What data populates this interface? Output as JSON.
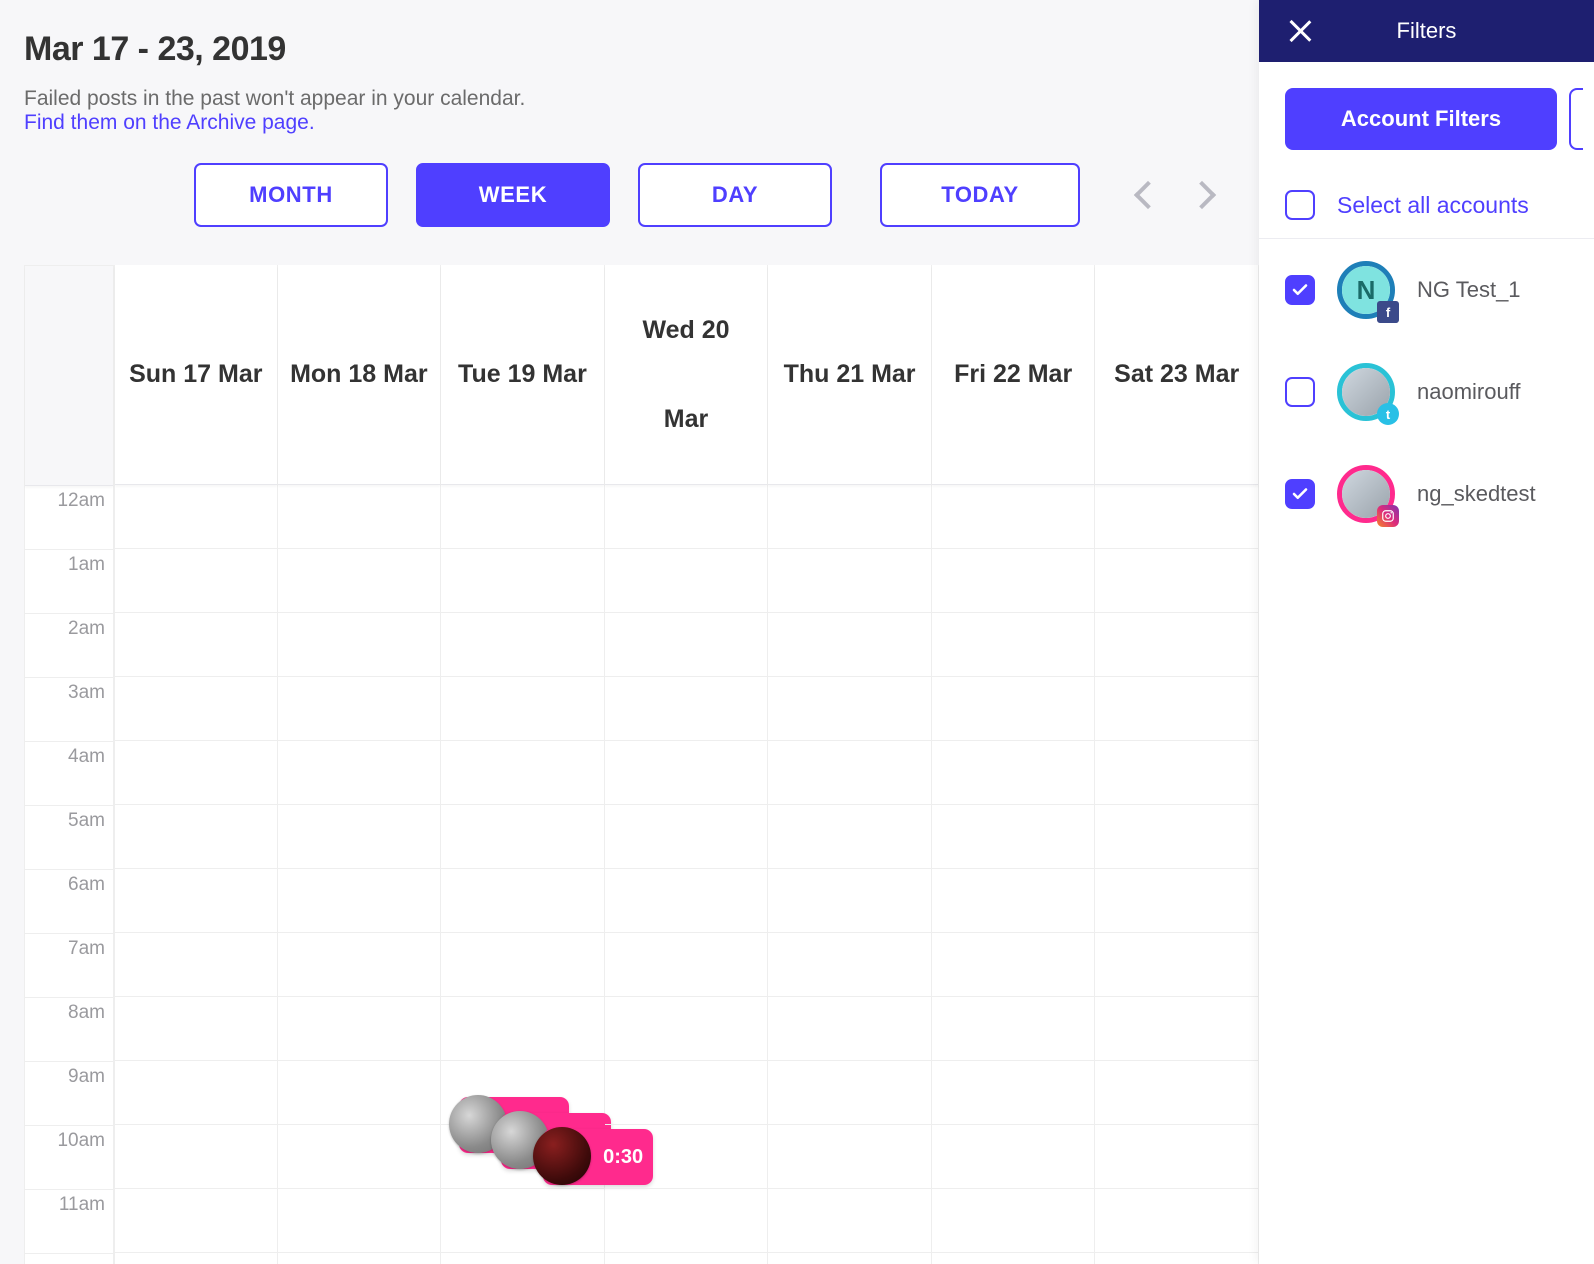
{
  "header": {
    "date_range": "Mar 17 - 23, 2019",
    "notice_text": "Failed posts in the past won't appear in your calendar.",
    "notice_link": "Find them on the Archive page."
  },
  "toolbar": {
    "month": "MONTH",
    "week": "WEEK",
    "day": "DAY",
    "today": "TODAY",
    "active_view": "week"
  },
  "calendar": {
    "days": [
      {
        "line1": "Sun 17 Mar",
        "line2": ""
      },
      {
        "line1": "Mon 18 Mar",
        "line2": ""
      },
      {
        "line1": "Tue 19 Mar",
        "line2": ""
      },
      {
        "line1": "Wed 20",
        "line2": "Mar"
      },
      {
        "line1": "Thu 21 Mar",
        "line2": ""
      },
      {
        "line1": "Fri 22 Mar",
        "line2": ""
      },
      {
        "line1": "Sat 23 Mar",
        "line2": ""
      }
    ],
    "hours": [
      "12am",
      "1am",
      "2am",
      "3am",
      "4am",
      "5am",
      "6am",
      "7am",
      "8am",
      "9am",
      "10am",
      "11am"
    ],
    "events": {
      "day_index": 2,
      "start_hour_index": 10,
      "visible_time_label": "0:30",
      "count": 3,
      "color": "#ff2a8d"
    }
  },
  "filters": {
    "title": "Filters",
    "account_filters_btn": "Account Filters",
    "select_all_label": "Select all accounts",
    "select_all_checked": false,
    "accounts": [
      {
        "name": "NG Test_1",
        "checked": true,
        "avatar_type": "letter",
        "letter": "N",
        "ring_color": "#1e7fb8",
        "badge": "fb"
      },
      {
        "name": "naomirouff",
        "checked": false,
        "avatar_type": "photo",
        "ring_color": "#2ac2d6",
        "badge": "tw"
      },
      {
        "name": "ng_skedtest",
        "checked": true,
        "avatar_type": "photo",
        "ring_color": "#ff2a8d",
        "badge": "ig"
      }
    ]
  }
}
